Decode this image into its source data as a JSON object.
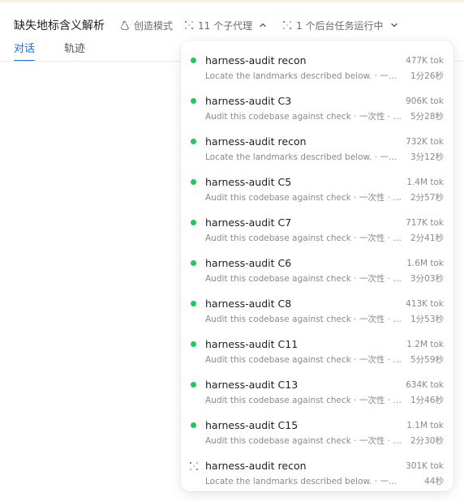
{
  "header": {
    "title": "缺失地标含义解析",
    "mode_label": "创造模式",
    "subagents_label": "11 个子代理",
    "background_label": "1 个后台任务运行中"
  },
  "tabs": [
    {
      "label": "对话",
      "active": true
    },
    {
      "label": "轨迹",
      "active": false
    }
  ],
  "colors": {
    "accent": "#1b6fe5",
    "status_running": "#22c55e",
    "status_pending": "#1b6fe5"
  },
  "agents": [
    {
      "name": "harness-audit recon",
      "desc": "Locate the landmarks described below. · 一次性 · 当前",
      "tokens": "477K tok",
      "time": "1分26秒",
      "status": "done"
    },
    {
      "name": "harness-audit C3",
      "desc": "Audit this codebase against check · 一次性 · 当前",
      "tokens": "906K tok",
      "time": "5分28秒",
      "status": "done"
    },
    {
      "name": "harness-audit recon",
      "desc": "Locate the landmarks described below. · 一次性 · 当前",
      "tokens": "732K tok",
      "time": "3分12秒",
      "status": "done"
    },
    {
      "name": "harness-audit C5",
      "desc": "Audit this codebase against check · 一次性 · 当前",
      "tokens": "1.4M tok",
      "time": "2分57秒",
      "status": "done"
    },
    {
      "name": "harness-audit C7",
      "desc": "Audit this codebase against check · 一次性 · 当前",
      "tokens": "717K tok",
      "time": "2分41秒",
      "status": "done"
    },
    {
      "name": "harness-audit C6",
      "desc": "Audit this codebase against check · 一次性 · 当前",
      "tokens": "1.6M tok",
      "time": "3分03秒",
      "status": "done"
    },
    {
      "name": "harness-audit C8",
      "desc": "Audit this codebase against check · 一次性 · 当前",
      "tokens": "413K tok",
      "time": "1分53秒",
      "status": "done"
    },
    {
      "name": "harness-audit C11",
      "desc": "Audit this codebase against check · 一次性 · 当前",
      "tokens": "1.2M tok",
      "time": "5分59秒",
      "status": "done"
    },
    {
      "name": "harness-audit C13",
      "desc": "Audit this codebase against check · 一次性 · 当前",
      "tokens": "634K tok",
      "time": "1分46秒",
      "status": "done"
    },
    {
      "name": "harness-audit C15",
      "desc": "Audit this codebase against check · 一次性 · 当前",
      "tokens": "1.1M tok",
      "time": "2分30秒",
      "status": "done"
    },
    {
      "name": "harness-audit recon",
      "desc": "Locate the landmarks described below. · 一次性 · 当前",
      "tokens": "301K tok",
      "time": "44秒",
      "status": "running"
    }
  ]
}
